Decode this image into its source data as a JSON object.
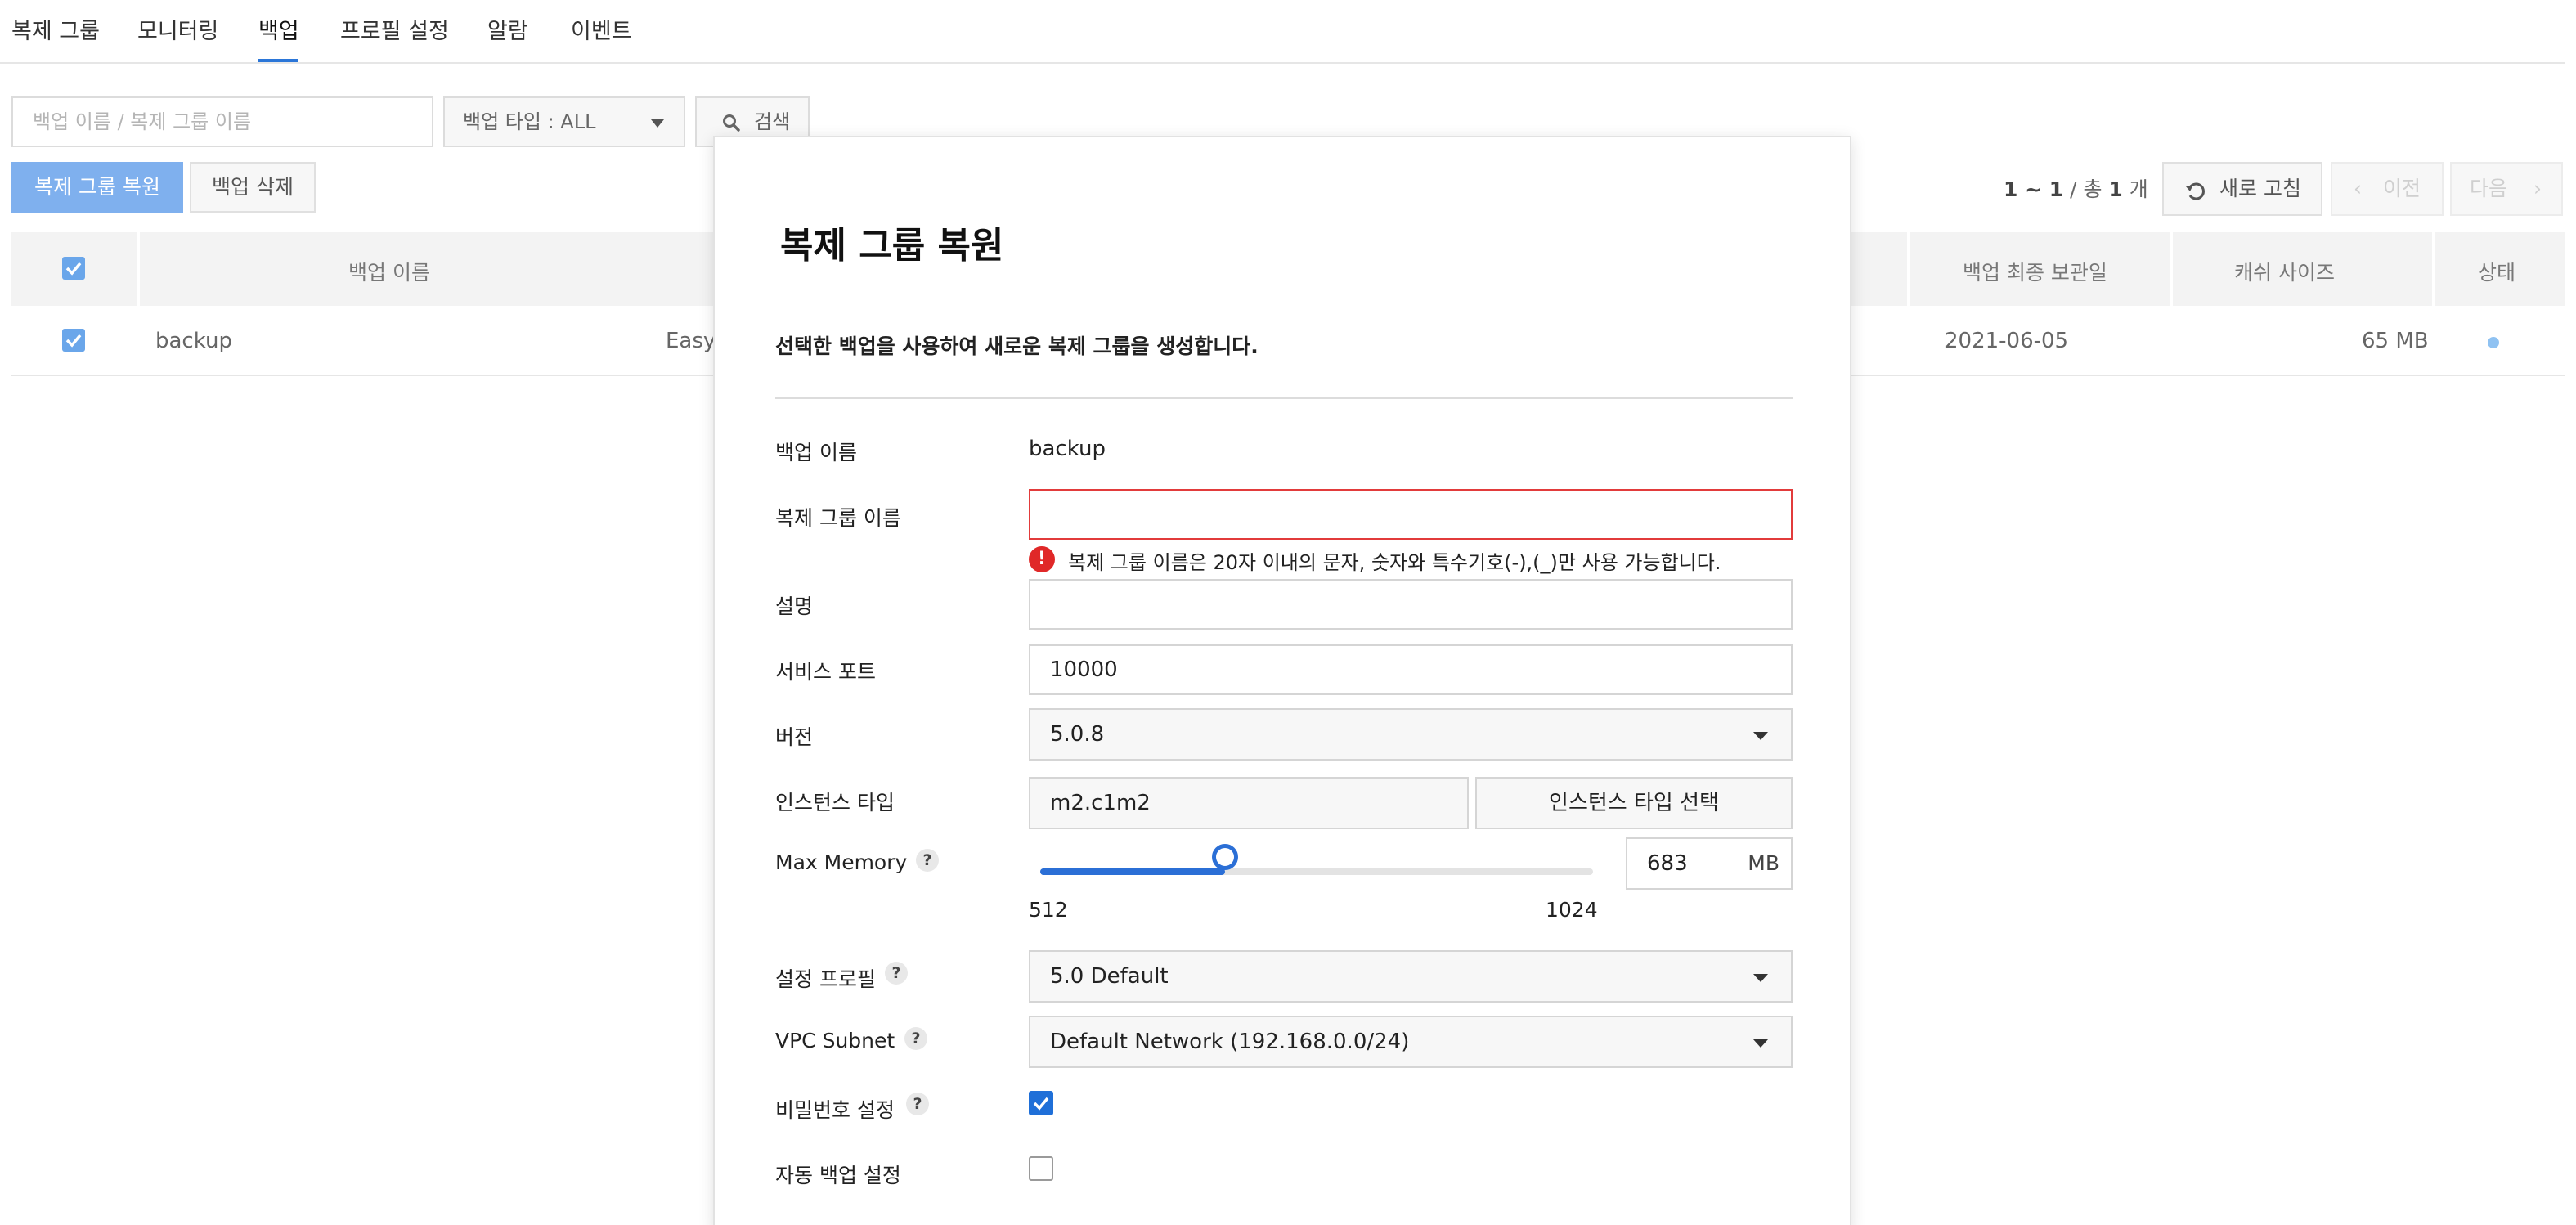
{
  "tabs": [
    {
      "label": "복제 그룹"
    },
    {
      "label": "모니터링"
    },
    {
      "label": "백업"
    },
    {
      "label": "프로필 설정"
    },
    {
      "label": "알람"
    },
    {
      "label": "이벤트"
    }
  ],
  "active_tab": "백업",
  "search": {
    "placeholder": "백업 이름 / 복제 그룹 이름",
    "type_select": "백업 타입 : ALL",
    "search_label": "검색"
  },
  "actions": {
    "restore_label": "복제 그룹 복원",
    "delete_label": "백업 삭제"
  },
  "pager": {
    "range": "1 ~ 1",
    "sep": " / 총 ",
    "total": "1",
    "unit": " 개",
    "refresh_label": "새로 고침",
    "prev_label": "이전",
    "next_label": "다음"
  },
  "table": {
    "headers": {
      "name": "백업 이름",
      "retention": "백업 최종 보관일",
      "cache_size": "캐쉬 사이즈",
      "status": "상태"
    },
    "rows": [
      {
        "name": "backup",
        "group": "EasyC",
        "retention": "2021-06-05",
        "cache_size": "65 MB",
        "checked": true
      }
    ]
  },
  "modal": {
    "title": "복제 그룹 복원",
    "description": "선택한 백업을 사용하여 새로운 복제 그룹을 생성합니다.",
    "fields": {
      "backup_name_label": "백업 이름",
      "backup_name_value": "backup",
      "group_name_label": "복제 그룹 이름",
      "group_name_value": "",
      "group_name_error": "복제 그룹 이름은 20자 이내의 문자, 숫자와 특수기호(-),(_)만 사용 가능합니다.",
      "description_label": "설명",
      "description_value": "",
      "port_label": "서비스 포트",
      "port_value": "10000",
      "version_label": "버전",
      "version_value": "5.0.8",
      "instance_type_label": "인스턴스 타입",
      "instance_type_value": "m2.c1m2",
      "instance_type_button": "인스턴스 타입 선택",
      "max_memory_label": "Max Memory",
      "max_memory_min": "512",
      "max_memory_max": "1024",
      "max_memory_value": "683",
      "max_memory_unit": "MB",
      "profile_label": "설정 프로필",
      "profile_value": "5.0 Default",
      "subnet_label": "VPC Subnet",
      "subnet_value": "Default Network (192.168.0.0/24)",
      "password_label": "비밀번호 설정",
      "password_checked": true,
      "auto_backup_label": "자동 백업 설정",
      "auto_backup_checked": false
    }
  },
  "colors": {
    "accent": "#2b6fd6",
    "primary_light": "#7fb0ee",
    "error": "#e23b3b",
    "status_dot": "#8fc2f2"
  }
}
